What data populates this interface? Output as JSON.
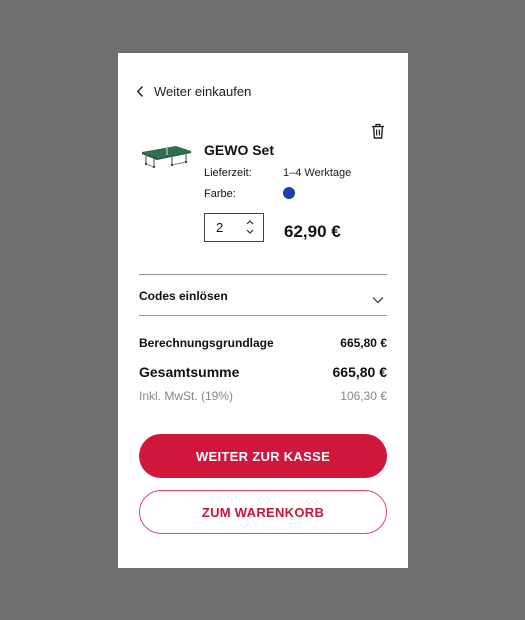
{
  "nav": {
    "back_label": "Weiter einkaufen"
  },
  "product": {
    "name": "GEWO Set",
    "delivery_label": "Lieferzeit:",
    "delivery_value": "1–4 Werktage",
    "color_label": "Farbe:",
    "color_swatch": "#1a3fb3",
    "quantity": "2",
    "price": "62,90 €"
  },
  "codes": {
    "label": "Codes einlösen"
  },
  "summary": {
    "base_label": "Berechnungsgrundlage",
    "base_value": "665,80 €",
    "total_label": "Gesamtsumme",
    "total_value": "665,80 €",
    "vat_label": "Inkl. MwSt. (19%)",
    "vat_value": "106,30 €"
  },
  "buttons": {
    "checkout": "WEITER ZUR KASSE",
    "cart": "ZUM WARENKORB"
  },
  "colors": {
    "accent": "#d1163b",
    "panel_bg": "#ffffff",
    "backdrop": "#6f6f6f"
  }
}
